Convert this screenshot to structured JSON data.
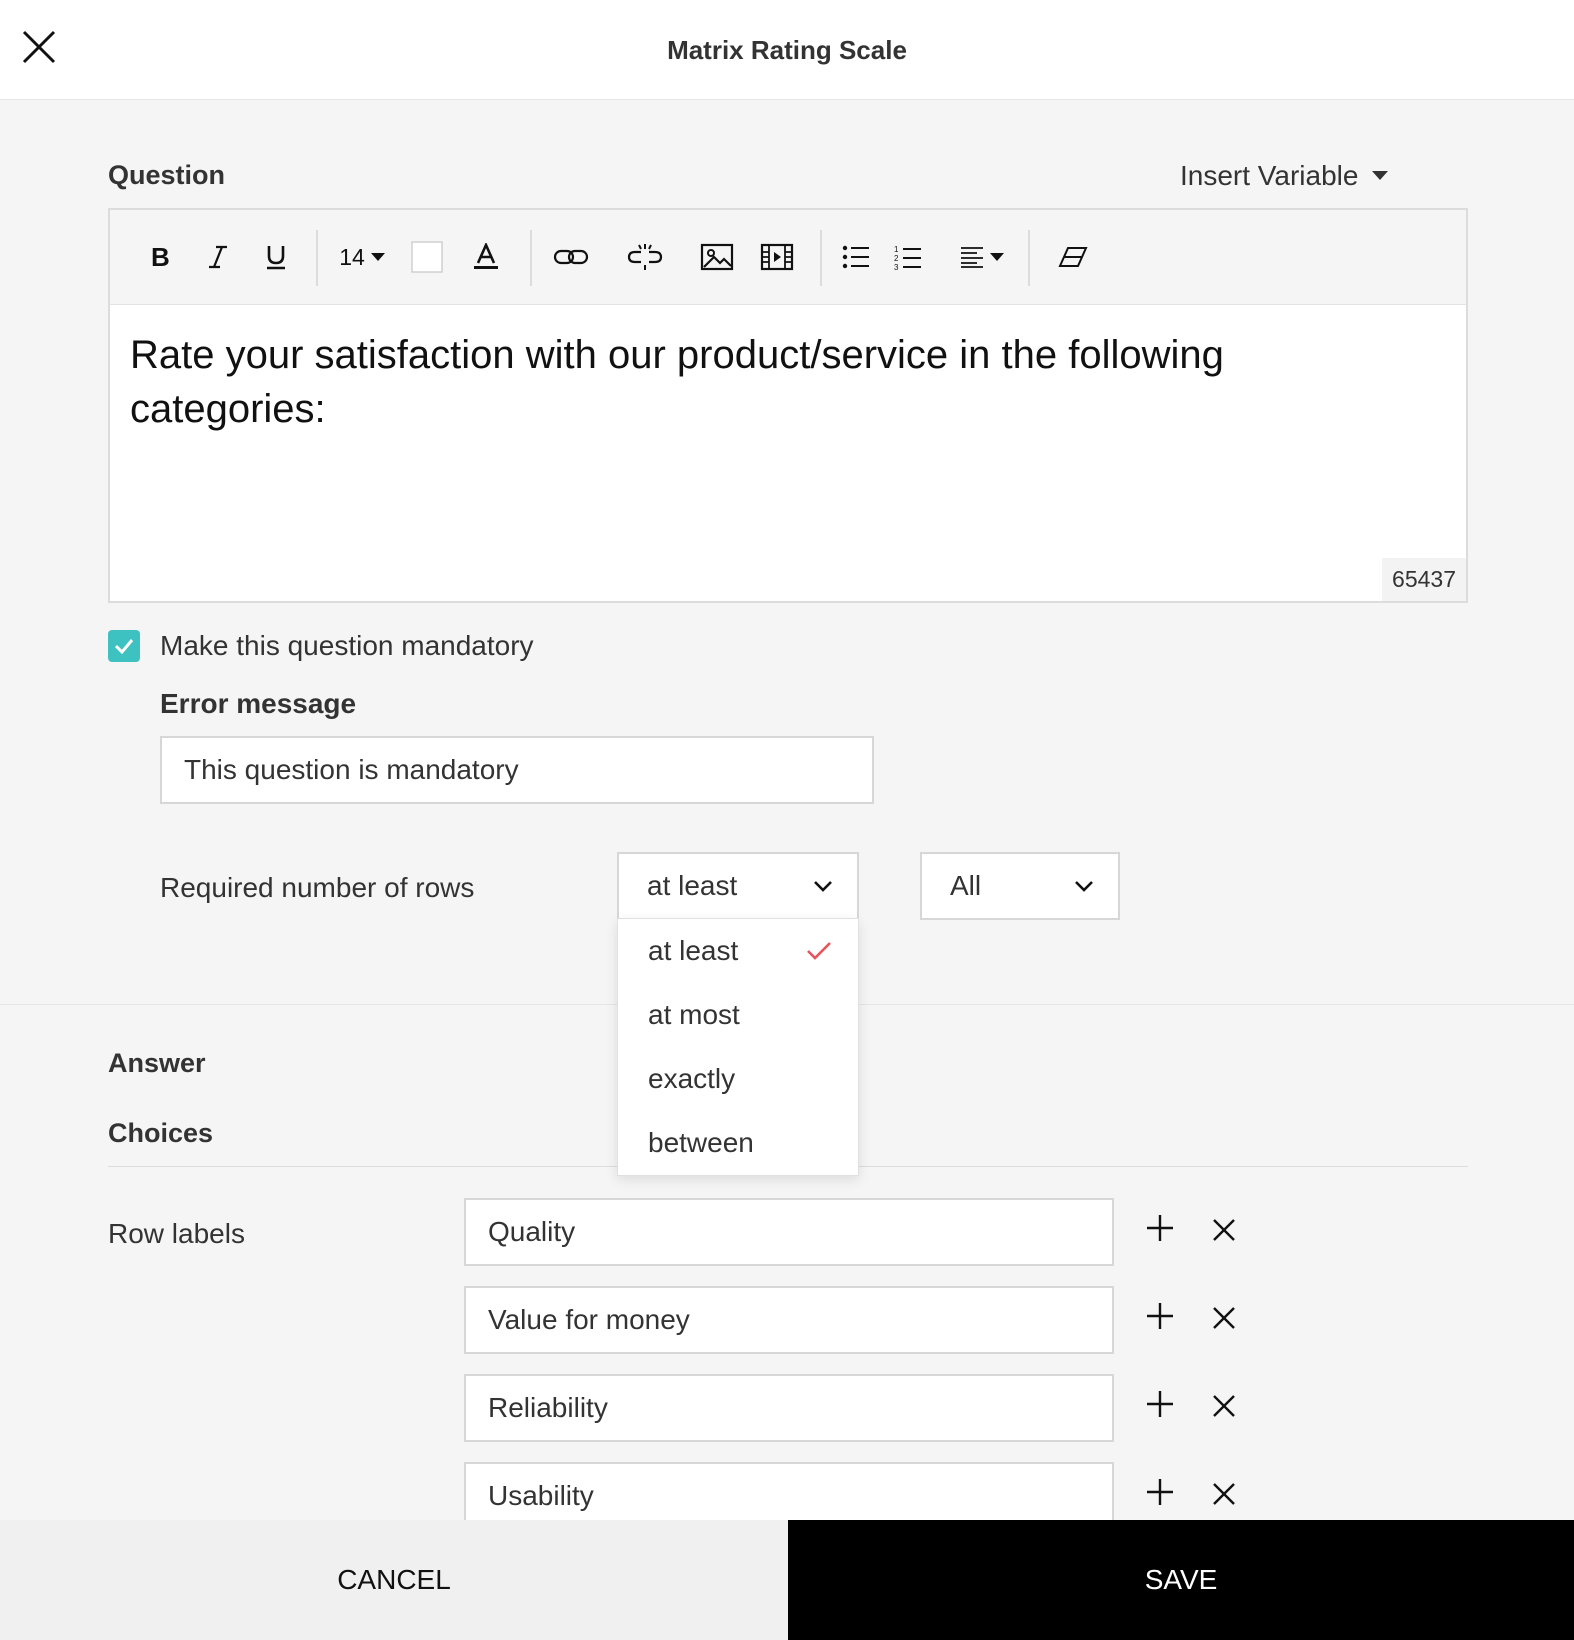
{
  "modal": {
    "title": "Matrix Rating Scale"
  },
  "question": {
    "section_label": "Question",
    "insert_variable_label": "Insert Variable",
    "font_size_value": "14",
    "text": "Rate your satisfaction with our product/service in the following categories:",
    "char_count": "65437"
  },
  "mandatory": {
    "checked": true,
    "label": "Make this question mandatory",
    "error_label": "Error message",
    "error_value": "This question is mandatory"
  },
  "required_rows": {
    "label": "Required number of rows",
    "comparator_value": "at least",
    "count_value": "All",
    "options": [
      "at least",
      "at most",
      "exactly",
      "between"
    ],
    "selected_index": 0
  },
  "answer": {
    "section_label": "Answer",
    "choices_label": "Choices",
    "row_labels_label": "Row labels",
    "rows": [
      "Quality",
      "Value for money",
      "Reliability",
      "Usability"
    ]
  },
  "footer": {
    "cancel_label": "CANCEL",
    "save_label": "SAVE"
  },
  "colors": {
    "checkbox": "#3ec1c1",
    "checkmark": "#e8545c",
    "save_bg": "#000000"
  }
}
